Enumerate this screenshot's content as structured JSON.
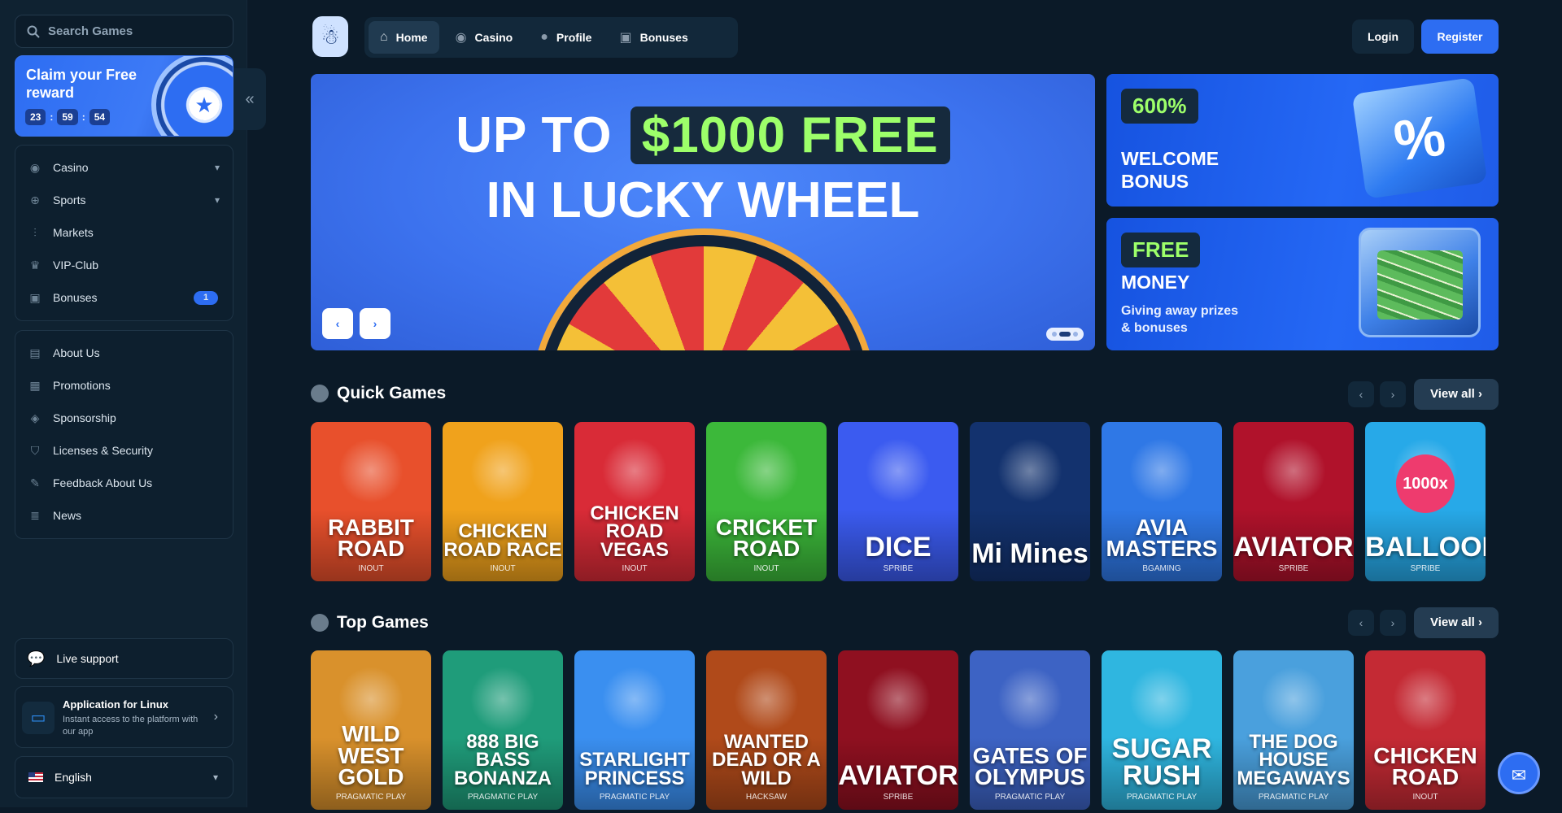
{
  "sidebar": {
    "search_placeholder": "Search Games",
    "reward": {
      "title": "Claim your Free reward",
      "timer": [
        "23",
        "59",
        "54"
      ]
    },
    "nav": [
      {
        "label": "Casino",
        "has_chevron": true
      },
      {
        "label": "Sports",
        "has_chevron": true
      },
      {
        "label": "Markets"
      },
      {
        "label": "VIP-Club"
      },
      {
        "label": "Bonuses",
        "badge": "1"
      }
    ],
    "info": [
      {
        "label": "About Us"
      },
      {
        "label": "Promotions"
      },
      {
        "label": "Sponsorship"
      },
      {
        "label": "Licenses & Security"
      },
      {
        "label": "Feedback About Us"
      },
      {
        "label": "News"
      }
    ],
    "live_support": "Live support",
    "app": {
      "title": "Application for Linux",
      "subtitle": "Instant access to the platform with our app"
    },
    "language": "English"
  },
  "header": {
    "tabs": [
      {
        "label": "Home",
        "icon": "home-icon"
      },
      {
        "label": "Casino",
        "icon": "chip-icon"
      },
      {
        "label": "Profile",
        "icon": "user-icon"
      },
      {
        "label": "Bonuses",
        "icon": "gift-icon"
      }
    ],
    "login": "Login",
    "register": "Register"
  },
  "hero": {
    "line1_pre": "UP TO",
    "line1_highlight": "$1000 FREE",
    "line2": "IN LUCKY WHEEL"
  },
  "promos": [
    {
      "pill": "600%",
      "title": "WELCOME BONUS",
      "subtitle": ""
    },
    {
      "pill": "FREE",
      "title": "MONEY",
      "subtitle": "Giving away prizes & bonuses"
    }
  ],
  "quick_games": {
    "title": "Quick Games",
    "view_all": "View all",
    "games": [
      {
        "name": "RABBIT ROAD",
        "provider": "INOUT",
        "color": "#e8502c"
      },
      {
        "name": "CHICKEN ROAD RACE",
        "provider": "INOUT",
        "color": "#f0a21c"
      },
      {
        "name": "CHICKEN ROAD VEGAS",
        "provider": "INOUT",
        "color": "#d92b37"
      },
      {
        "name": "CRICKET ROAD",
        "provider": "INOUT",
        "color": "#3cb83a"
      },
      {
        "name": "DICE",
        "provider": "SPRIBE",
        "color": "#3b5bf0"
      },
      {
        "name": "Mi Mines",
        "provider": "",
        "color": "#13326e"
      },
      {
        "name": "AVIA MASTERS",
        "provider": "BGAMING",
        "color": "#2f78e6"
      },
      {
        "name": "AVIATOR",
        "provider": "SPRIBE",
        "color": "#b0122b"
      },
      {
        "name": "BALLOON",
        "provider": "SPRIBE",
        "color": "#27a9e8",
        "badge": "1000x"
      }
    ]
  },
  "top_games": {
    "title": "Top Games",
    "view_all": "View all",
    "games": [
      {
        "name": "WILD WEST GOLD",
        "provider": "PRAGMATIC PLAY",
        "color": "#d9912c"
      },
      {
        "name": "888 BIG BASS BONANZA",
        "provider": "PRAGMATIC PLAY",
        "color": "#1f9c7a"
      },
      {
        "name": "STARLIGHT PRINCESS",
        "provider": "PRAGMATIC PLAY",
        "color": "#3a8ff0"
      },
      {
        "name": "WANTED DEAD OR A WILD",
        "provider": "HACKSAW",
        "color": "#b04a1a"
      },
      {
        "name": "AVIATOR",
        "provider": "SPRIBE",
        "color": "#8f1020"
      },
      {
        "name": "GATES OF OLYMPUS",
        "provider": "PRAGMATIC PLAY",
        "color": "#3d63c4"
      },
      {
        "name": "SUGAR RUSH",
        "provider": "PRAGMATIC PLAY",
        "color": "#2fb6e0"
      },
      {
        "name": "THE DOG HOUSE MEGAWAYS",
        "provider": "PRAGMATIC PLAY",
        "color": "#4aa0dd"
      },
      {
        "name": "CHICKEN ROAD",
        "provider": "INOUT",
        "color": "#c42a34"
      }
    ]
  }
}
